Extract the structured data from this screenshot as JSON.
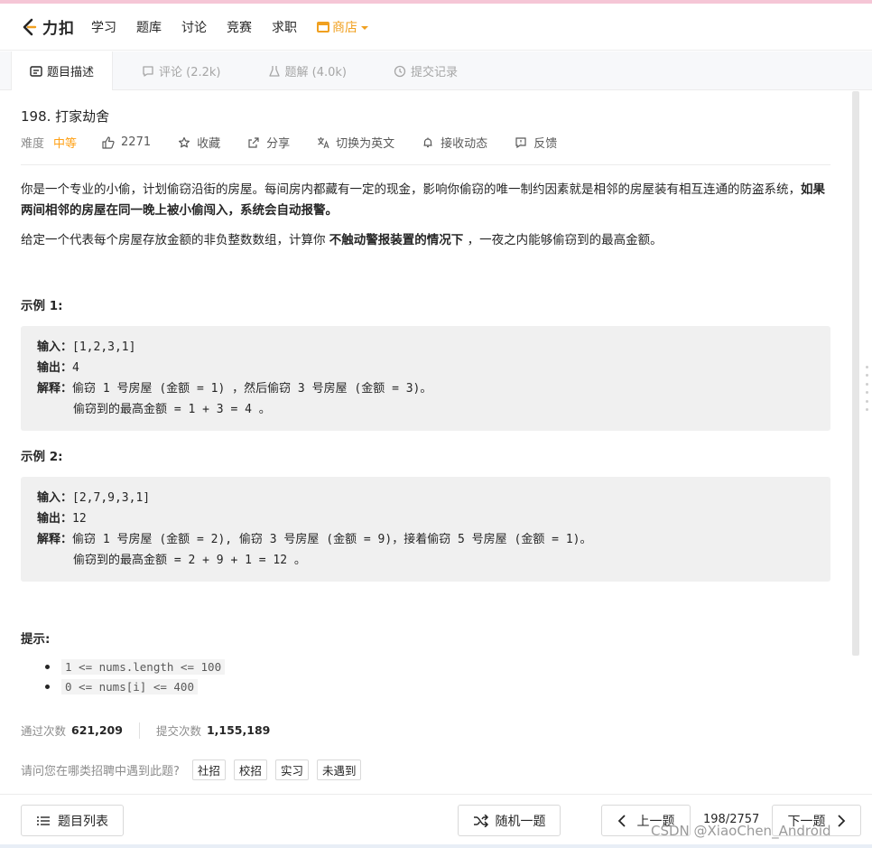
{
  "nav": {
    "logo_text": "力扣",
    "items": [
      "学习",
      "题库",
      "讨论",
      "竞赛",
      "求职"
    ],
    "shop_label": "商店"
  },
  "tabs": [
    {
      "label": "题目描述",
      "active": true
    },
    {
      "label": "评论 (2.2k)",
      "active": false
    },
    {
      "label": "题解 (4.0k)",
      "active": false
    },
    {
      "label": "提交记录",
      "active": false
    }
  ],
  "problem": {
    "title": "198. 打家劫舍",
    "difficulty_label": "难度",
    "difficulty_value": "中等",
    "likes": "2271",
    "favorite_label": "收藏",
    "share_label": "分享",
    "switch_lang_label": "切换为英文",
    "subscribe_label": "接收动态",
    "feedback_label": "反馈"
  },
  "description": {
    "p1_part1": "你是一个专业的小偷，计划偷窃沿街的房屋。每间房内都藏有一定的现金，影响你偷窃的唯一制约因素就是相邻的房屋装有相互连通的防盗系统，",
    "p1_bold": "如果两间相邻的房屋在同一晚上被小偷闯入，系统会自动报警。",
    "p2_part1": "给定一个代表每个房屋存放金额的非负整数数组，计算你 ",
    "p2_bold": "不触动警报装置的情况下",
    "p2_part2": " ，一夜之内能够偷窃到的最高金额。"
  },
  "example1": {
    "title": "示例 1:",
    "input_label": "输入：",
    "input_value": "[1,2,3,1]",
    "output_label": "输出：",
    "output_value": "4",
    "explain_label": "解释：",
    "explain_line1": "偷窃 1 号房屋 (金额 = 1) ，然后偷窃 3 号房屋 (金额 = 3)。",
    "explain_line2": "偷窃到的最高金额 = 1 + 3 = 4 。"
  },
  "example2": {
    "title": "示例 2:",
    "input_label": "输入：",
    "input_value": "[2,7,9,3,1]",
    "output_label": "输出：",
    "output_value": "12",
    "explain_label": "解释：",
    "explain_line1": "偷窃 1 号房屋 (金额 = 2), 偷窃 3 号房屋 (金额 = 9)，接着偷窃 5 号房屋 (金额 = 1)。",
    "explain_line2": "偷窃到的最高金额 = 2 + 9 + 1 = 12 。"
  },
  "hints": {
    "title": "提示:",
    "items": [
      "1 <= nums.length <= 100",
      "0 <= nums[i] <= 400"
    ]
  },
  "stats": {
    "accepted_label": "通过次数",
    "accepted_value": "621,209",
    "submitted_label": "提交次数",
    "submitted_value": "1,155,189"
  },
  "survey": {
    "question": "请问您在哪类招聘中遇到此题?",
    "options": [
      "社招",
      "校招",
      "实习",
      "未遇到"
    ]
  },
  "bottom": {
    "list_label": "题目列表",
    "random_label": "随机一题",
    "prev_label": "上一题",
    "page": "198/2757",
    "next_label": "下一题",
    "watermark": "CSDN @XiaoChen_Android"
  },
  "colors": {
    "accent": "#ffa116",
    "shop": "#f0a020"
  }
}
